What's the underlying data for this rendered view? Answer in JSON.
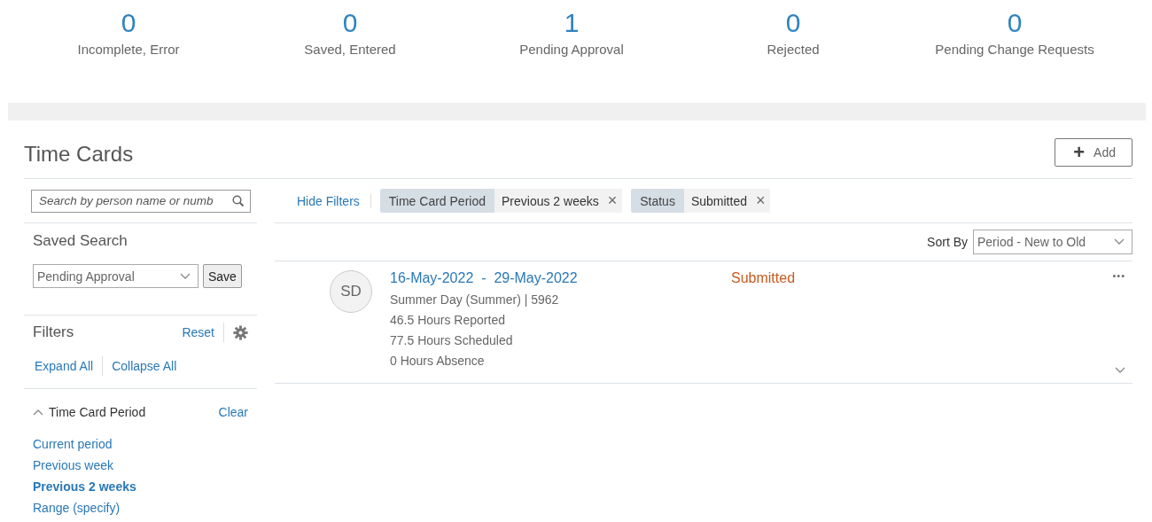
{
  "summary": [
    {
      "value": "0",
      "label": "Incomplete, Error"
    },
    {
      "value": "0",
      "label": "Saved, Entered"
    },
    {
      "value": "1",
      "label": "Pending Approval"
    },
    {
      "value": "0",
      "label": "Rejected"
    },
    {
      "value": "0",
      "label": "Pending Change Requests"
    }
  ],
  "title": "Time Cards",
  "add_button": {
    "icon": "+",
    "label": "Add"
  },
  "search": {
    "placeholder": "Search by person name or numb"
  },
  "saved_search": {
    "heading": "Saved Search",
    "value": "Pending Approval",
    "save_button": "Save"
  },
  "filters": {
    "heading": "Filters",
    "reset": "Reset",
    "expand_all": "Expand All",
    "collapse_all": "Collapse All",
    "groups": [
      {
        "label": "Time Card Period",
        "expanded": true,
        "clear": "Clear",
        "options": [
          {
            "label": "Current period",
            "selected": false
          },
          {
            "label": "Previous week",
            "selected": false
          },
          {
            "label": "Previous 2 weeks",
            "selected": true
          },
          {
            "label": "Range (specify)",
            "selected": false
          }
        ]
      }
    ]
  },
  "hide_filters": "Hide Filters",
  "chips": [
    {
      "name": "Time Card Period",
      "value": "Previous 2 weeks",
      "remove": "×"
    },
    {
      "name": "Status",
      "value": "Submitted",
      "remove": "×"
    }
  ],
  "sort": {
    "label": "Sort By",
    "value": "Period - New to Old"
  },
  "cards": [
    {
      "initials": "SD",
      "period": "16-May-2022  -  29-May-2022",
      "status": "Submitted",
      "more": "•••",
      "expanded": false,
      "details": [
        "Summer Day (Summer) | 5962",
        "46.5 Hours Reported",
        "77.5 Hours Scheduled",
        "0 Hours Absence"
      ]
    }
  ]
}
